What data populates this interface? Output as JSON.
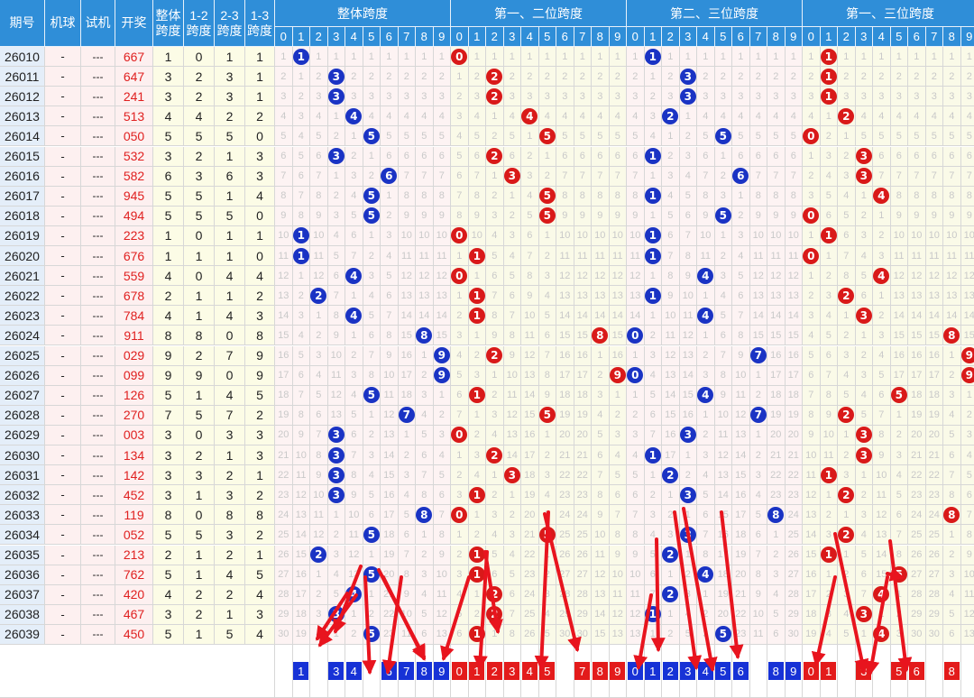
{
  "headers": {
    "period": "期号",
    "machine": "机球",
    "trial": "试机",
    "draw": "开奖",
    "overall_span": "整体跨度",
    "span12": "1-2跨度",
    "span23": "2-3跨度",
    "span13": "1-3跨度"
  },
  "groups": [
    {
      "title": "整体跨度",
      "color": "blue"
    },
    {
      "title": "第一、二位跨度",
      "color": "red"
    },
    {
      "title": "第二、三位跨度",
      "color": "blue"
    },
    {
      "title": "第一、三位跨度",
      "color": "red"
    }
  ],
  "digits": [
    "0",
    "1",
    "2",
    "3",
    "4",
    "5",
    "6",
    "7",
    "8",
    "9"
  ],
  "rows": [
    {
      "period": "26010",
      "machine": "-",
      "trial": "---",
      "draw": "667",
      "spans": [
        "1",
        "0",
        "1",
        "1"
      ]
    },
    {
      "period": "26011",
      "machine": "-",
      "trial": "---",
      "draw": "647",
      "spans": [
        "3",
        "2",
        "3",
        "1"
      ]
    },
    {
      "period": "26012",
      "machine": "-",
      "trial": "---",
      "draw": "241",
      "spans": [
        "3",
        "2",
        "3",
        "1"
      ]
    },
    {
      "period": "26013",
      "machine": "-",
      "trial": "---",
      "draw": "513",
      "spans": [
        "4",
        "4",
        "2",
        "2"
      ]
    },
    {
      "period": "26014",
      "machine": "-",
      "trial": "---",
      "draw": "050",
      "spans": [
        "5",
        "5",
        "5",
        "0"
      ]
    },
    {
      "period": "26015",
      "machine": "-",
      "trial": "---",
      "draw": "532",
      "spans": [
        "3",
        "2",
        "1",
        "3"
      ]
    },
    {
      "period": "26016",
      "machine": "-",
      "trial": "---",
      "draw": "582",
      "spans": [
        "6",
        "3",
        "6",
        "3"
      ]
    },
    {
      "period": "26017",
      "machine": "-",
      "trial": "---",
      "draw": "945",
      "spans": [
        "5",
        "5",
        "1",
        "4"
      ]
    },
    {
      "period": "26018",
      "machine": "-",
      "trial": "---",
      "draw": "494",
      "spans": [
        "5",
        "5",
        "5",
        "0"
      ]
    },
    {
      "period": "26019",
      "machine": "-",
      "trial": "---",
      "draw": "223",
      "spans": [
        "1",
        "0",
        "1",
        "1"
      ]
    },
    {
      "period": "26020",
      "machine": "-",
      "trial": "---",
      "draw": "676",
      "spans": [
        "1",
        "1",
        "1",
        "0"
      ]
    },
    {
      "period": "26021",
      "machine": "-",
      "trial": "---",
      "draw": "559",
      "spans": [
        "4",
        "0",
        "4",
        "4"
      ]
    },
    {
      "period": "26022",
      "machine": "-",
      "trial": "---",
      "draw": "678",
      "spans": [
        "2",
        "1",
        "1",
        "2"
      ]
    },
    {
      "period": "26023",
      "machine": "-",
      "trial": "---",
      "draw": "784",
      "spans": [
        "4",
        "1",
        "4",
        "3"
      ]
    },
    {
      "period": "26024",
      "machine": "-",
      "trial": "---",
      "draw": "911",
      "spans": [
        "8",
        "8",
        "0",
        "8"
      ]
    },
    {
      "period": "26025",
      "machine": "-",
      "trial": "---",
      "draw": "029",
      "spans": [
        "9",
        "2",
        "7",
        "9"
      ]
    },
    {
      "period": "26026",
      "machine": "-",
      "trial": "---",
      "draw": "099",
      "spans": [
        "9",
        "9",
        "0",
        "9"
      ]
    },
    {
      "period": "26027",
      "machine": "-",
      "trial": "---",
      "draw": "126",
      "spans": [
        "5",
        "1",
        "4",
        "5"
      ]
    },
    {
      "period": "26028",
      "machine": "-",
      "trial": "---",
      "draw": "270",
      "spans": [
        "7",
        "5",
        "7",
        "2"
      ]
    },
    {
      "period": "26029",
      "machine": "-",
      "trial": "---",
      "draw": "003",
      "spans": [
        "3",
        "0",
        "3",
        "3"
      ]
    },
    {
      "period": "26030",
      "machine": "-",
      "trial": "---",
      "draw": "134",
      "spans": [
        "3",
        "2",
        "1",
        "3"
      ]
    },
    {
      "period": "26031",
      "machine": "-",
      "trial": "---",
      "draw": "142",
      "spans": [
        "3",
        "3",
        "2",
        "1"
      ]
    },
    {
      "period": "26032",
      "machine": "-",
      "trial": "---",
      "draw": "452",
      "spans": [
        "3",
        "1",
        "3",
        "2"
      ]
    },
    {
      "period": "26033",
      "machine": "-",
      "trial": "---",
      "draw": "119",
      "spans": [
        "8",
        "0",
        "8",
        "8"
      ]
    },
    {
      "period": "26034",
      "machine": "-",
      "trial": "---",
      "draw": "052",
      "spans": [
        "5",
        "5",
        "3",
        "2"
      ]
    },
    {
      "period": "26035",
      "machine": "-",
      "trial": "---",
      "draw": "213",
      "spans": [
        "2",
        "1",
        "2",
        "1"
      ]
    },
    {
      "period": "26036",
      "machine": "-",
      "trial": "---",
      "draw": "762",
      "spans": [
        "5",
        "1",
        "4",
        "5"
      ]
    },
    {
      "period": "26037",
      "machine": "-",
      "trial": "---",
      "draw": "420",
      "spans": [
        "4",
        "2",
        "2",
        "4"
      ]
    },
    {
      "period": "26038",
      "machine": "-",
      "trial": "---",
      "draw": "467",
      "spans": [
        "3",
        "2",
        "1",
        "3"
      ]
    },
    {
      "period": "26039",
      "machine": "-",
      "trial": "---",
      "draw": "450",
      "spans": [
        "5",
        "1",
        "5",
        "4"
      ]
    }
  ],
  "footer_picks": [
    [
      "1",
      "3",
      "4",
      "6",
      "7",
      "8",
      "9"
    ],
    [
      "0",
      "1",
      "2",
      "3",
      "4",
      "5",
      "7",
      "8",
      "9"
    ],
    [
      "0",
      "1",
      "2",
      "3",
      "4",
      "5",
      "6",
      "8",
      "9"
    ],
    [
      "0",
      "1",
      "3",
      "5",
      "6",
      "8"
    ]
  ],
  "colors": {
    "header_blue": "#2f8ed8",
    "ball_blue": "#1a33c4",
    "ball_red": "#d91919",
    "draw_red": "#e02020",
    "arrow_red": "#e8141e"
  }
}
